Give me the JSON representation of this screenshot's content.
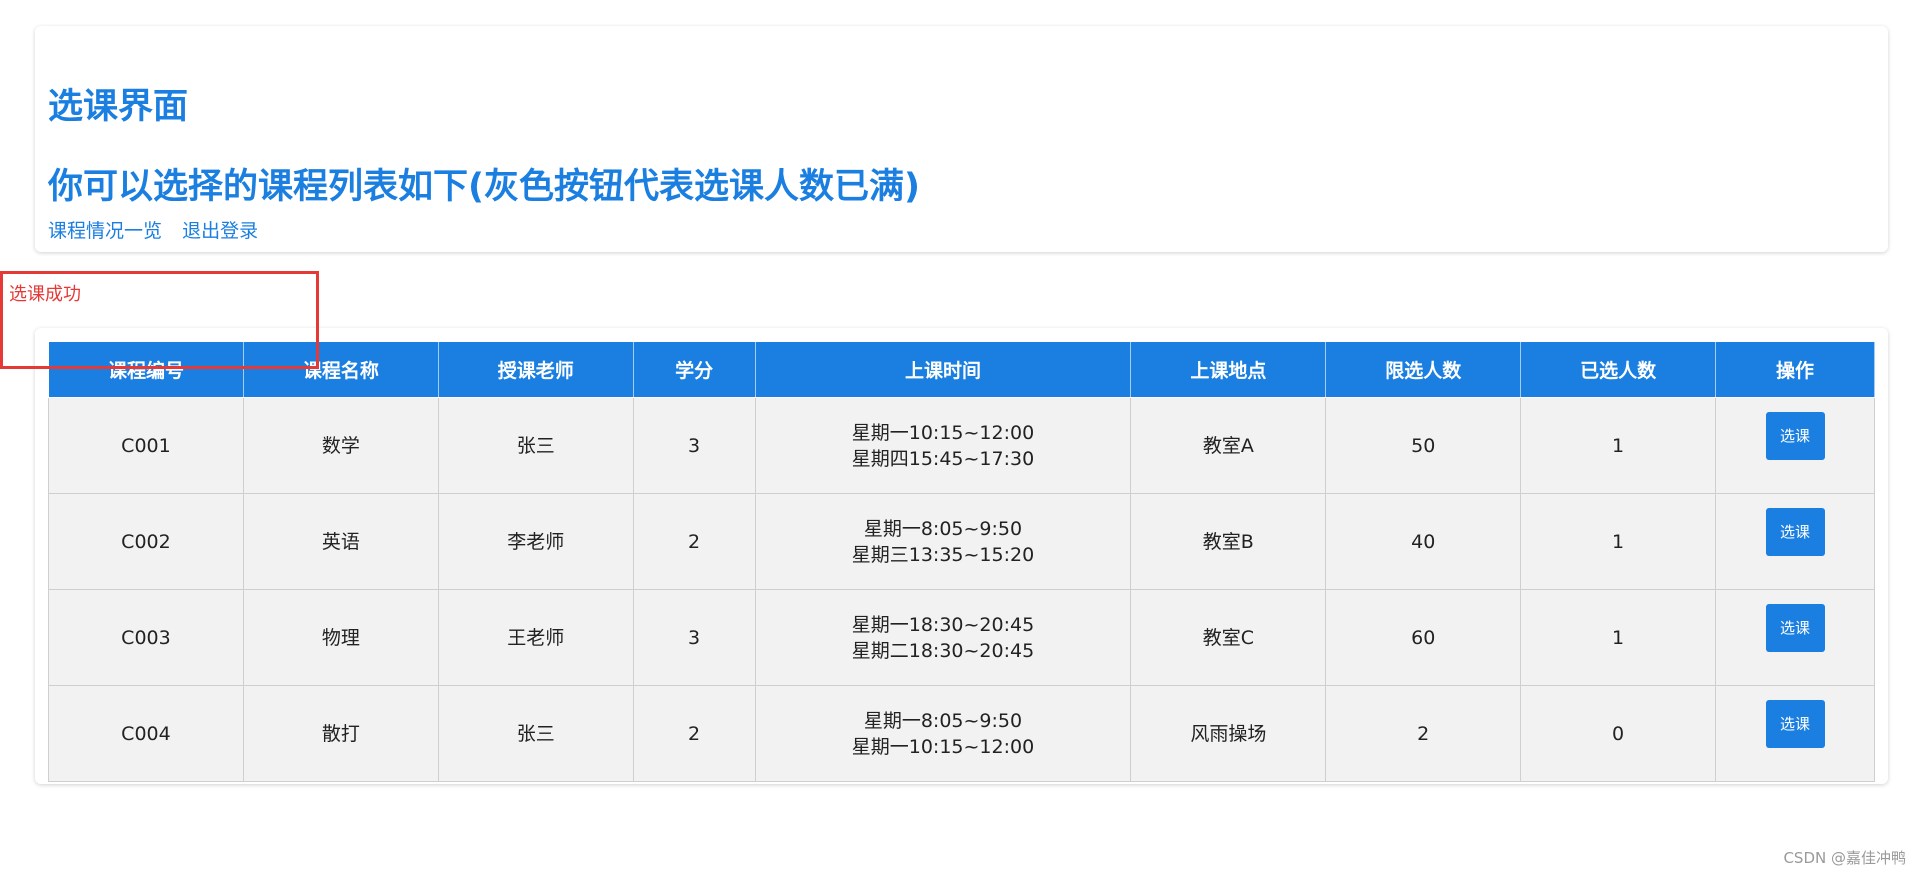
{
  "header": {
    "title": "选课界面",
    "subtitle": "你可以选择的课程列表如下(灰色按钮代表选课人数已满)",
    "links": [
      "课程情况一览",
      "退出登录"
    ]
  },
  "message": "选课成功",
  "table": {
    "columns": [
      "课程编号",
      "课程名称",
      "授课老师",
      "学分",
      "上课时间",
      "上课地点",
      "限选人数",
      "已选人数",
      "操作"
    ],
    "rows": [
      {
        "id": "C001",
        "name": "数学",
        "teacher": "张三",
        "credit": "3",
        "time": [
          "星期一10:15~12:00",
          "星期四15:45~17:30"
        ],
        "place": "教室A",
        "limit": "50",
        "selected": "1",
        "action": "选课"
      },
      {
        "id": "C002",
        "name": "英语",
        "teacher": "李老师",
        "credit": "2",
        "time": [
          "星期一8:05~9:50",
          "星期三13:35~15:20"
        ],
        "place": "教室B",
        "limit": "40",
        "selected": "1",
        "action": "选课"
      },
      {
        "id": "C003",
        "name": "物理",
        "teacher": "王老师",
        "credit": "3",
        "time": [
          "星期一18:30~20:45",
          "星期二18:30~20:45"
        ],
        "place": "教室C",
        "limit": "60",
        "selected": "1",
        "action": "选课"
      },
      {
        "id": "C004",
        "name": "散打",
        "teacher": "张三",
        "credit": "2",
        "time": [
          "星期一8:05~9:50",
          "星期一10:15~12:00"
        ],
        "place": "风雨操场",
        "limit": "2",
        "selected": "0",
        "action": "选课"
      }
    ]
  },
  "colors": {
    "accent": "#1a7fe0",
    "message": "#e53935",
    "cell_bg": "#f2f2f2"
  },
  "watermark": "CSDN @嘉佳冲鸭"
}
